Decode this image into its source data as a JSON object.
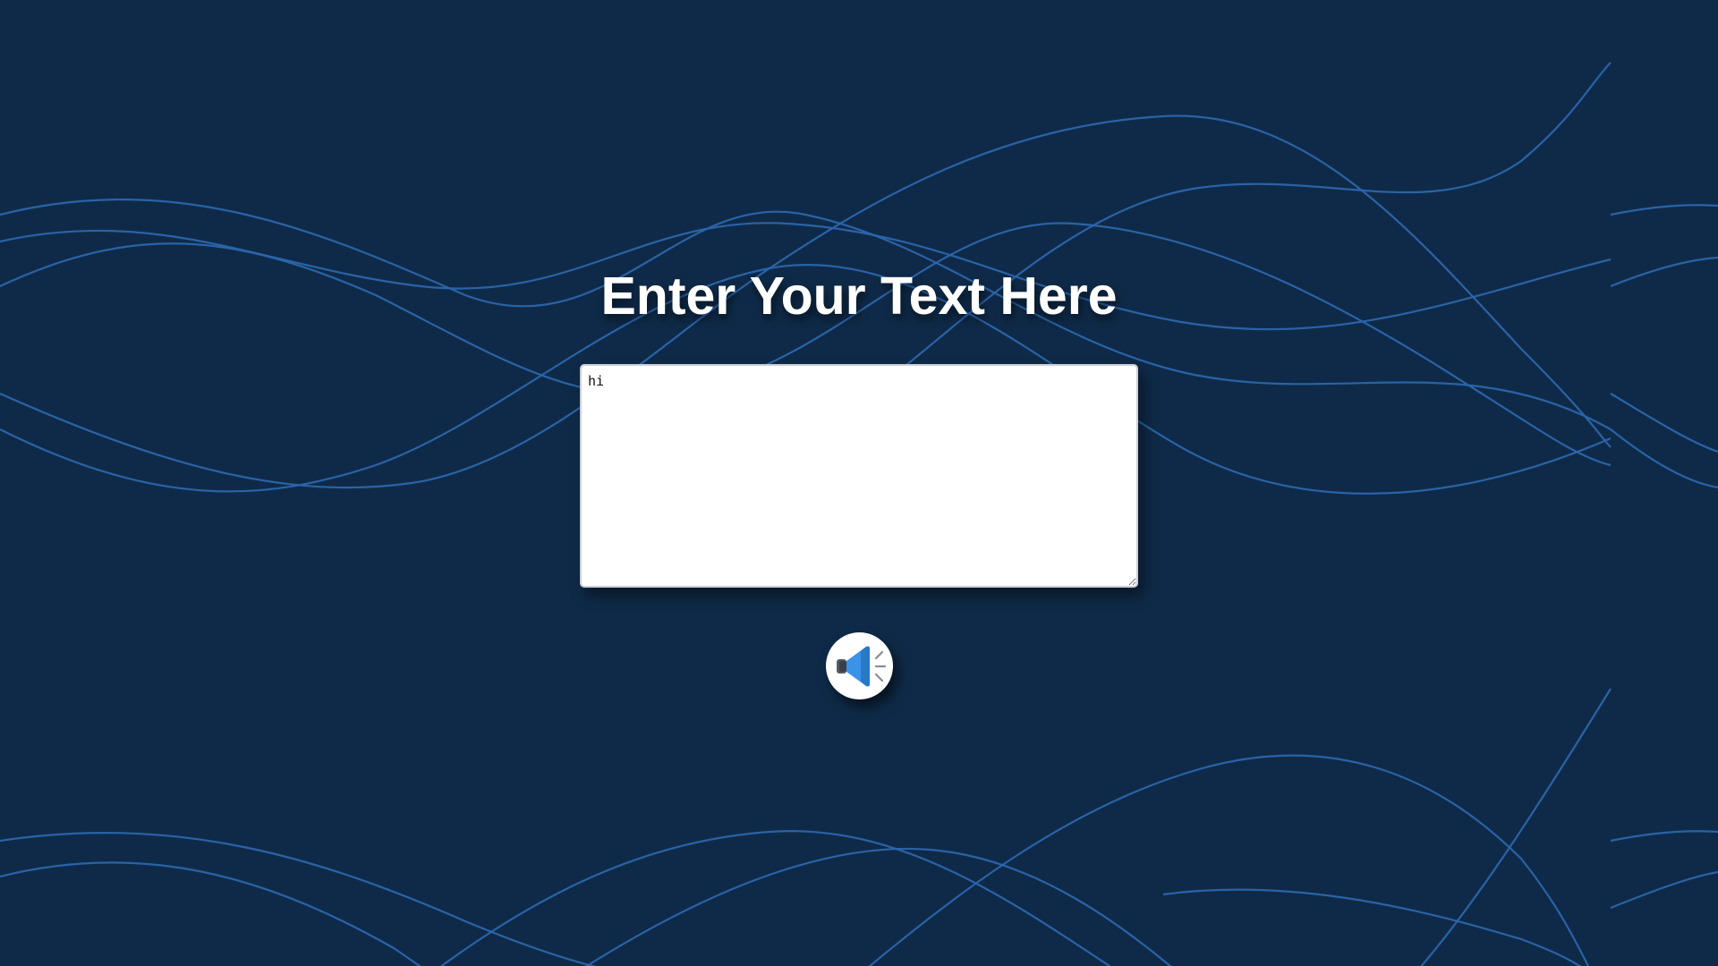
{
  "page": {
    "title": "Enter Your Text Here",
    "background_color": "#0f2a48",
    "wave_color": "#2b66ad"
  },
  "input": {
    "value": "hi"
  },
  "speak_button": {
    "icon": "speaker-icon",
    "icon_color": "#3a93e6"
  }
}
